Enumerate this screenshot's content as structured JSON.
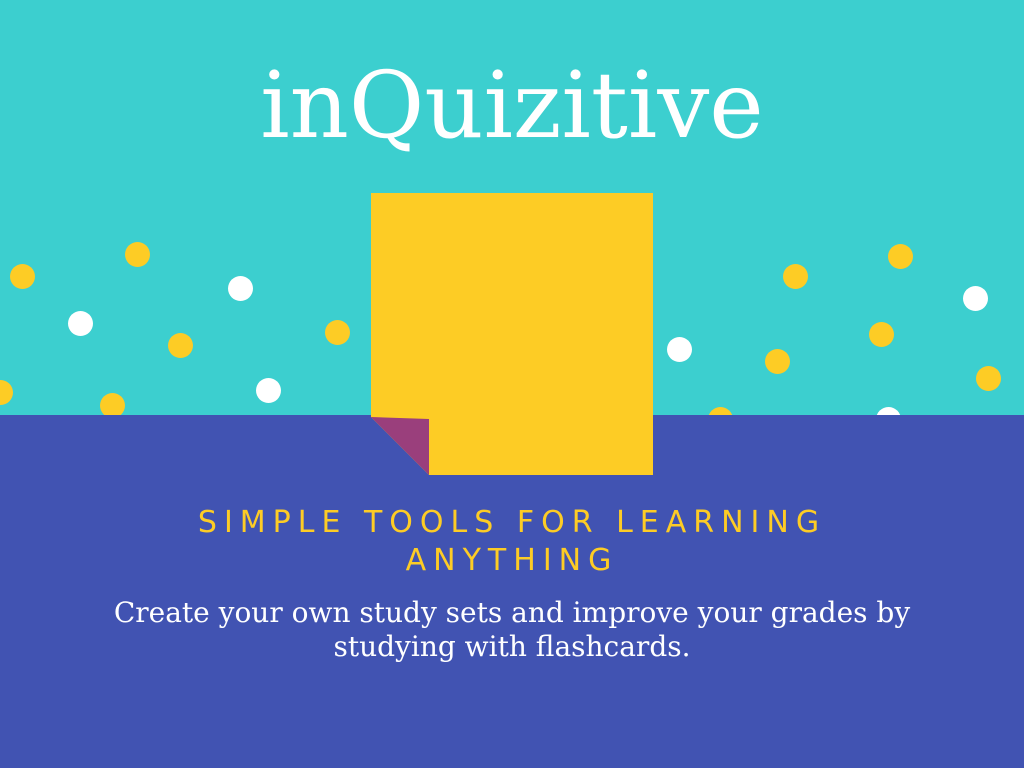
{
  "brand": {
    "title": "inQuizitive"
  },
  "hero": {
    "tagline": "SIMPLE TOOLS FOR LEARNING ANYTHING",
    "description": "Create your own study sets and improve your grades by studying with flashcards."
  },
  "colors": {
    "teal": "#3ccfcf",
    "indigo": "#4153b2",
    "yellow": "#fdcc25",
    "white": "#ffffff",
    "fold": "#9a3f7c"
  }
}
